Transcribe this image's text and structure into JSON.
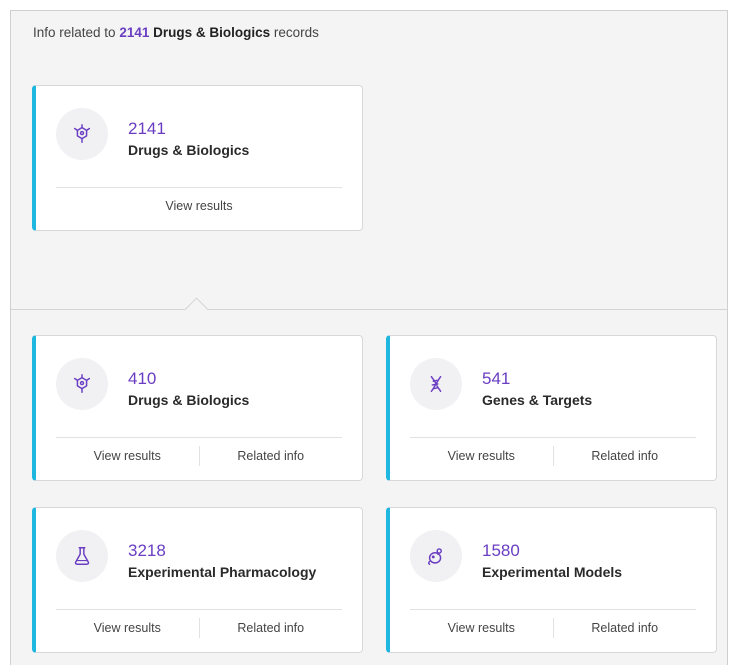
{
  "header": {
    "prefix": "Info related to",
    "count": "2141",
    "category": "Drugs & Biologics",
    "suffix": "records"
  },
  "primary_card": {
    "count": "2141",
    "label": "Drugs & Biologics",
    "icon": "drug-molecule-icon",
    "view_results": "View results"
  },
  "related_cards": [
    {
      "count": "410",
      "label": "Drugs & Biologics",
      "icon": "drug-molecule-icon",
      "view_results": "View results",
      "related_info": "Related info"
    },
    {
      "count": "541",
      "label": "Genes & Targets",
      "icon": "dna-icon",
      "view_results": "View results",
      "related_info": "Related info"
    },
    {
      "count": "3218",
      "label": "Experimental Pharmacology",
      "icon": "flask-icon",
      "view_results": "View results",
      "related_info": "Related info"
    },
    {
      "count": "1580",
      "label": "Experimental Models",
      "icon": "mouse-model-icon",
      "view_results": "View results",
      "related_info": "Related info"
    }
  ],
  "colors": {
    "accent_bar": "#1fb6e0",
    "count_purple": "#6a3ec2"
  }
}
